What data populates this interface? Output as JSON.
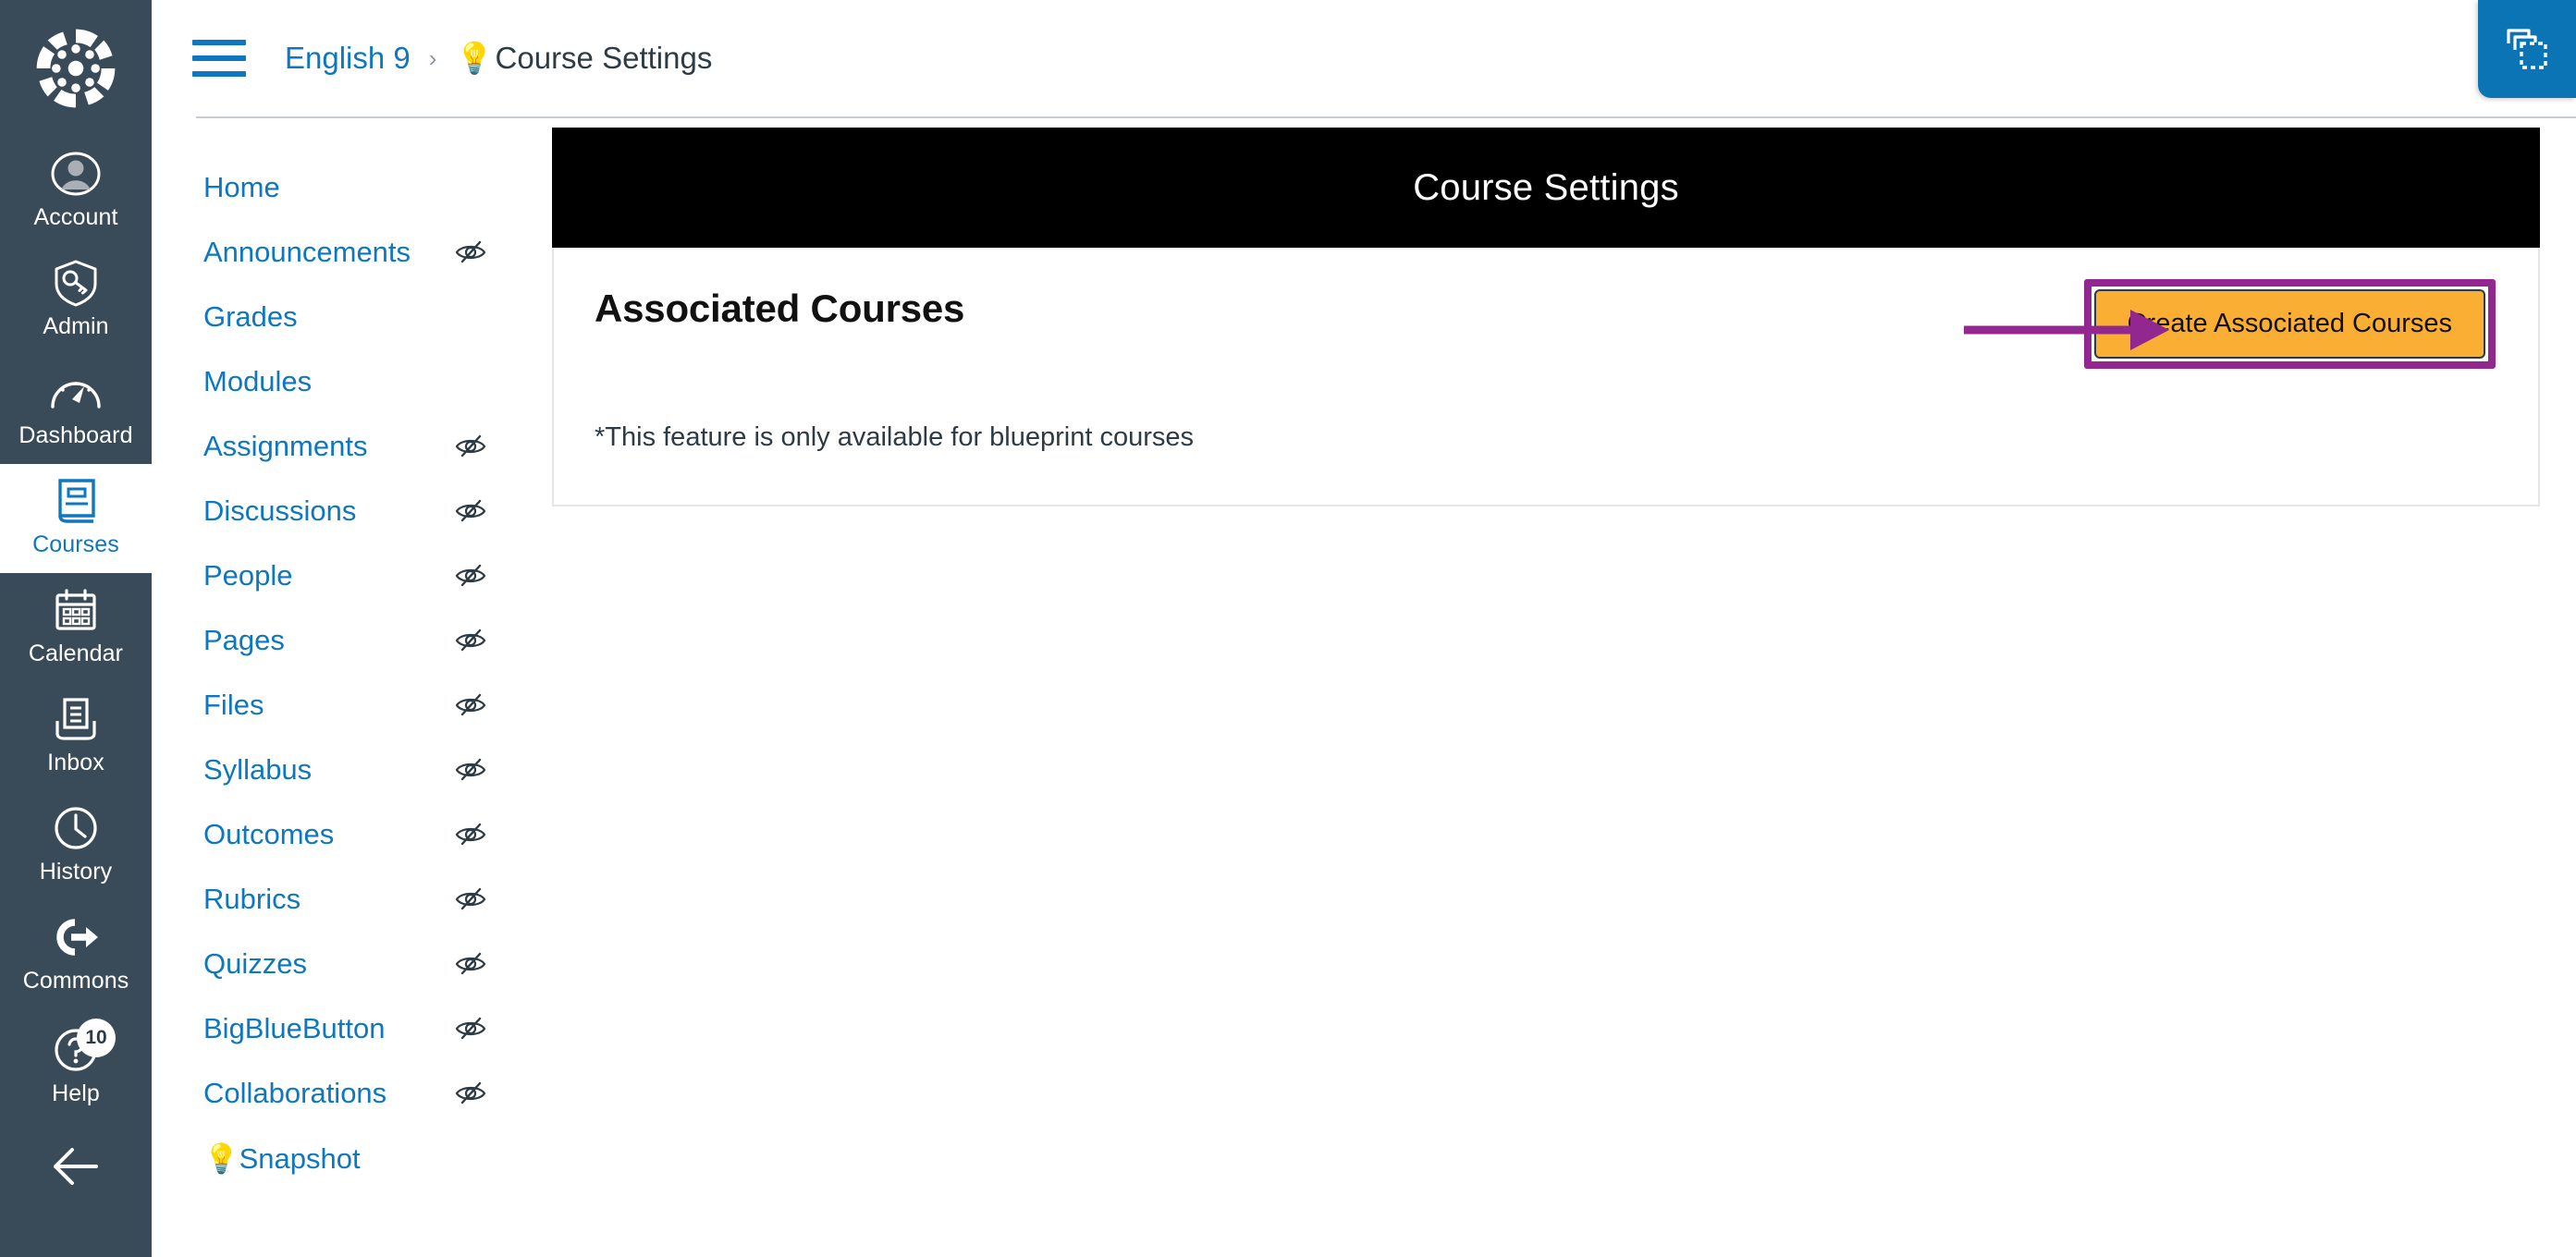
{
  "global_nav": {
    "logo_name": "canvas-logo",
    "items": [
      {
        "label": "Account",
        "icon": "user-avatar-icon",
        "active": false
      },
      {
        "label": "Admin",
        "icon": "shield-key-icon",
        "active": false
      },
      {
        "label": "Dashboard",
        "icon": "gauge-icon",
        "active": false
      },
      {
        "label": "Courses",
        "icon": "book-icon",
        "active": true
      },
      {
        "label": "Calendar",
        "icon": "calendar-icon",
        "active": false
      },
      {
        "label": "Inbox",
        "icon": "inbox-tray-icon",
        "active": false
      },
      {
        "label": "History",
        "icon": "clock-icon",
        "active": false
      },
      {
        "label": "Commons",
        "icon": "commons-arrow-icon",
        "active": false
      },
      {
        "label": "Help",
        "icon": "question-circle-icon",
        "active": false,
        "badge": "10"
      }
    ],
    "collapse_icon": "collapse-arrow-icon"
  },
  "header": {
    "menu_icon": "hamburger-menu-icon",
    "breadcrumb": {
      "course_link": "English 9",
      "separator": "›",
      "current_icon": "💡",
      "current": "Course Settings"
    },
    "blueprint_icon": "blueprint-copy-icon"
  },
  "course_nav": {
    "items": [
      {
        "label": "Home",
        "hidden": false
      },
      {
        "label": "Announcements",
        "hidden": true
      },
      {
        "label": "Grades",
        "hidden": false
      },
      {
        "label": "Modules",
        "hidden": false
      },
      {
        "label": "Assignments",
        "hidden": true
      },
      {
        "label": "Discussions",
        "hidden": true
      },
      {
        "label": "People",
        "hidden": true
      },
      {
        "label": "Pages",
        "hidden": true
      },
      {
        "label": "Files",
        "hidden": true
      },
      {
        "label": "Syllabus",
        "hidden": true
      },
      {
        "label": "Outcomes",
        "hidden": true
      },
      {
        "label": "Rubrics",
        "hidden": true
      },
      {
        "label": "Quizzes",
        "hidden": true
      },
      {
        "label": "BigBlueButton",
        "hidden": true
      },
      {
        "label": "Collaborations",
        "hidden": true
      },
      {
        "label": "💡Snapshot",
        "hidden": false
      }
    ],
    "hidden_icon": "eye-slash-icon"
  },
  "main": {
    "banner_title": "Course Settings",
    "section_title": "Associated Courses",
    "note": "*This feature is only available for blueprint courses",
    "cta_label": "Create Associated Courses"
  },
  "annotation": {
    "arrow_icon": "pointer-arrow-icon",
    "highlight_color": "#92278F",
    "button_color": "#FBAE34"
  },
  "colors": {
    "nav_bg": "#394B59",
    "link_blue": "#0E77BF",
    "banner_bg": "#000000",
    "blueprint_blue": "#0A74B5"
  }
}
